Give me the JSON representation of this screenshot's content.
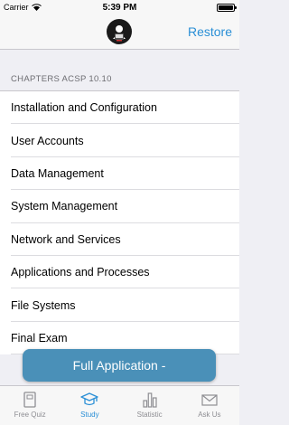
{
  "status": {
    "carrier": "Carrier",
    "time": "5:39 PM"
  },
  "nav": {
    "restore_label": "Restore"
  },
  "section_header": "CHAPTERS ACSP 10.10",
  "chapters": [
    "Installation and Configuration",
    "User Accounts",
    "Data Management",
    "System Management",
    "Network and Services",
    "Applications and Processes",
    "File Systems",
    "Final Exam"
  ],
  "full_app_label": "Full Application -",
  "tabs": [
    {
      "label": "Free Quiz",
      "icon": "book-icon"
    },
    {
      "label": "Study",
      "icon": "graduation-cap-icon"
    },
    {
      "label": "Statistic",
      "icon": "bar-chart-icon"
    },
    {
      "label": "Ask Us",
      "icon": "envelope-icon"
    }
  ],
  "active_tab": "Study",
  "colors": {
    "accent": "#2a8fd6",
    "button": "#4a90b8",
    "background": "#efeff4",
    "inactive": "#8e8e93"
  }
}
